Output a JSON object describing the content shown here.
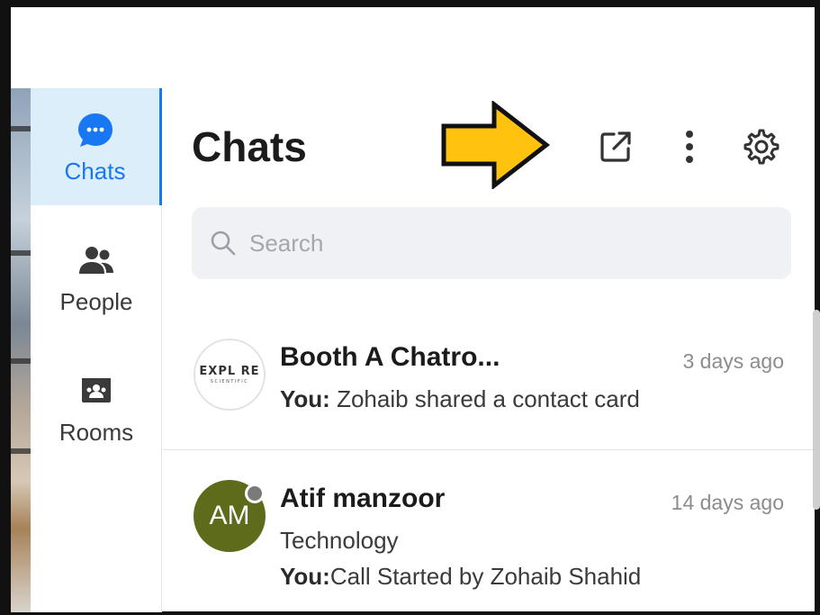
{
  "sidebar": {
    "items": [
      {
        "label": "Chats",
        "icon": "chat-bubble-icon",
        "active": true
      },
      {
        "label": "People",
        "icon": "people-icon",
        "active": false
      },
      {
        "label": "Rooms",
        "icon": "room-icon",
        "active": false
      }
    ]
  },
  "header": {
    "title": "Chats",
    "actions": {
      "popout_icon": "external-link-icon",
      "more_icon": "more-vertical-icon",
      "settings_icon": "gear-icon"
    }
  },
  "annotation": {
    "arrow_color": "#FFC20E",
    "icon": "arrow-right-icon"
  },
  "search": {
    "placeholder": "Search",
    "value": ""
  },
  "chats": [
    {
      "name": "Booth A Chatro...",
      "time": "3 days ago",
      "avatar_logo": {
        "main": "EXPL RE",
        "sub": "SCIENTIFIC"
      },
      "preview_prefix": "You:",
      "preview": " Zohaib shared a contact card"
    },
    {
      "name": "Atif manzoor",
      "time": "14 days ago",
      "avatar_initials": "AM",
      "subtitle": "Technology",
      "preview_prefix": "You:",
      "preview": "Call Started by Zohaib Shahid"
    }
  ],
  "colors": {
    "accent": "#1877F2",
    "active_bg": "#DDEEFB",
    "avatar_am": "#5D6B1A",
    "search_bg": "#F0F1F5"
  }
}
